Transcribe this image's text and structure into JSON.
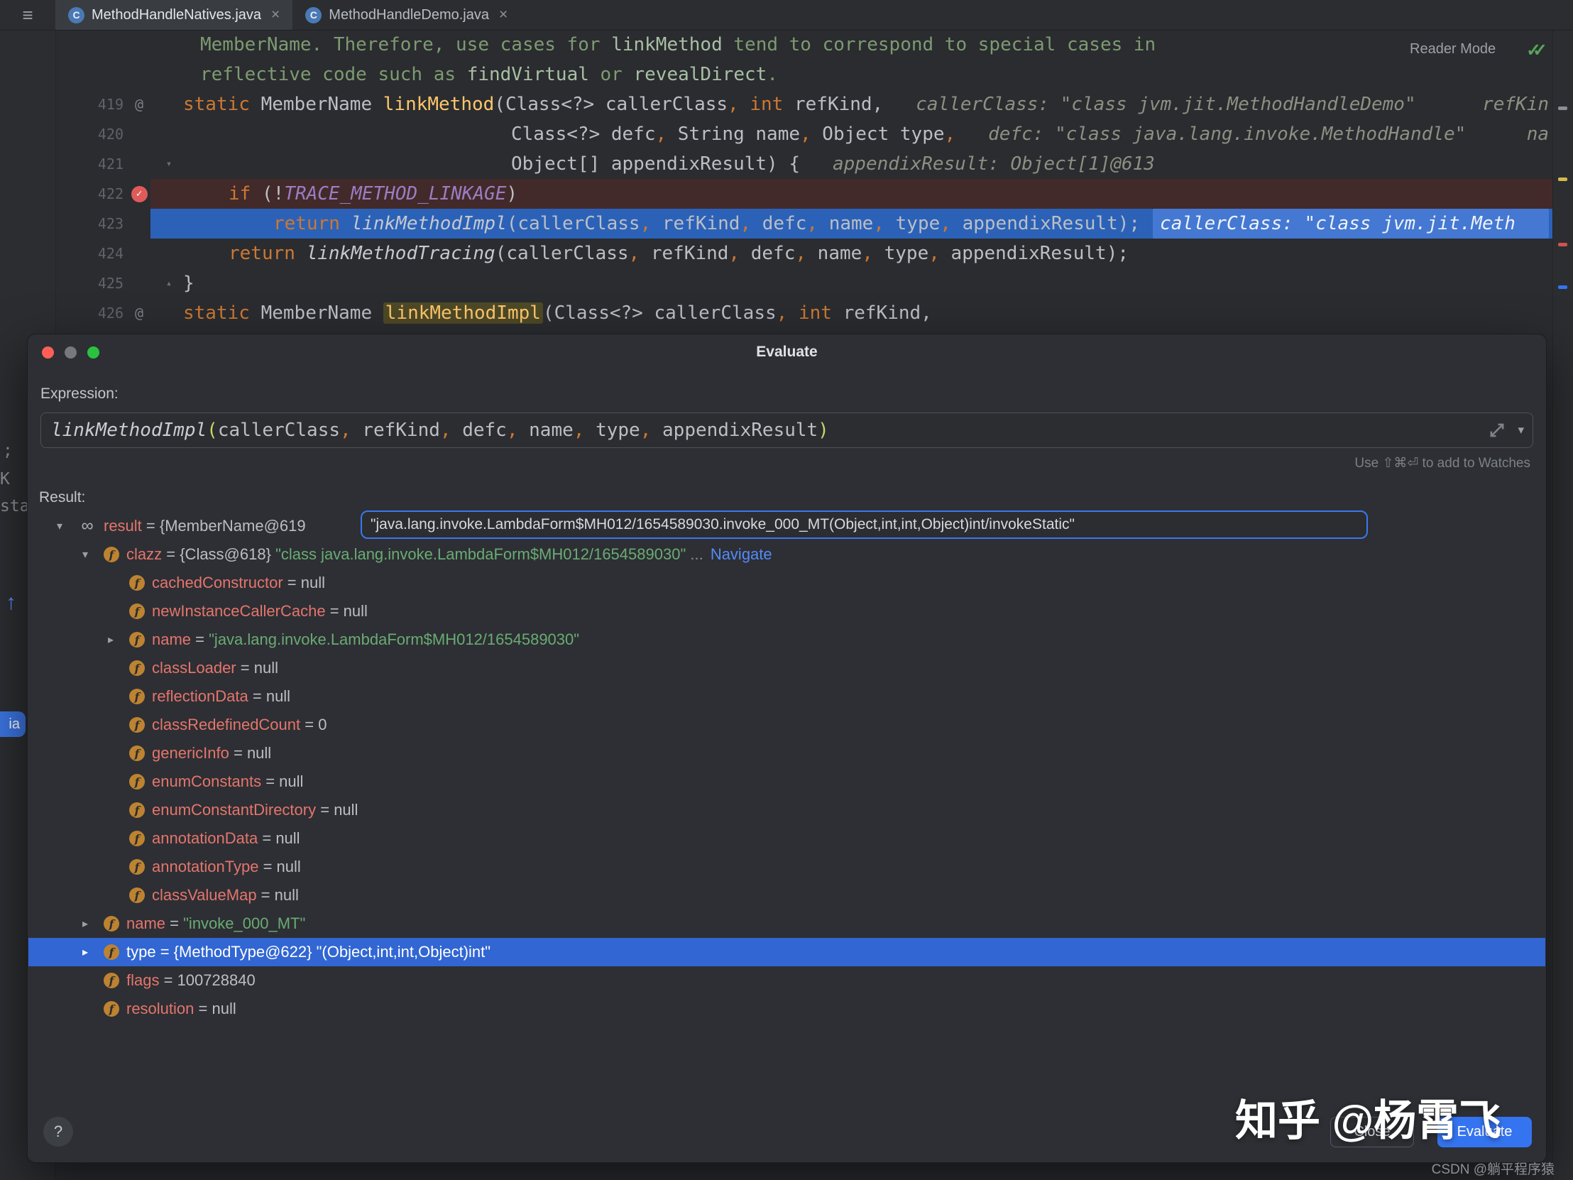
{
  "tabs": [
    {
      "label": "MethodHandleNatives.java",
      "close": "×"
    },
    {
      "label": "MethodHandleDemo.java",
      "close": "×"
    }
  ],
  "editor": {
    "reader_mode": "Reader Mode",
    "inspection_icon": "✓✓",
    "hamburger_icon": "≡",
    "lines": [
      {
        "indent": 24,
        "tokens": [
          {
            "t": "MemberName. Therefore, use cases for ",
            "c": "comment"
          },
          {
            "t": "linkMethod",
            "c": "ccode"
          },
          {
            "t": " tend to correspond to special cases in",
            "c": "comment"
          }
        ]
      },
      {
        "indent": 24,
        "tokens": [
          {
            "t": "reflective code such as ",
            "c": "comment"
          },
          {
            "t": "findVirtual",
            "c": "ccode"
          },
          {
            "t": " or ",
            "c": "comment"
          },
          {
            "t": "revealDirect",
            "c": "ccode"
          },
          {
            "t": ".",
            "c": "comment"
          }
        ]
      },
      {
        "num": "419",
        "gutter": "at",
        "indent": 0,
        "tokens": [
          {
            "t": "static ",
            "c": "kw"
          },
          {
            "t": "MemberName ",
            "c": "plain"
          },
          {
            "t": "linkMethod",
            "c": "decl"
          },
          {
            "t": "(Class<?> callerClass, ",
            "c": "args"
          },
          {
            "t": "int",
            "c": "kw"
          },
          {
            "t": " refKind,",
            "c": "plain"
          }
        ],
        "hint": "callerClass: \"class jvm.jit.MethodHandleDemo\"",
        "hint2": "refKin"
      },
      {
        "num": "420",
        "indent": 462,
        "tokens": [
          {
            "t": "Class<?> defc, String name, Object type,",
            "c": "args"
          }
        ],
        "hint": "defc: \"class java.lang.invoke.MethodHandle\"",
        "hint2": "na"
      },
      {
        "num": "421",
        "gutter": "fold",
        "indent": 462,
        "tokens": [
          {
            "t": "Object[] appendixResult) {",
            "c": "args"
          }
        ],
        "hint": "appendixResult: Object[1]@613"
      },
      {
        "num": "422",
        "gutter": "breakpoint",
        "bg": "bp",
        "indent": 64,
        "tokens": [
          {
            "t": "if",
            "c": "kw"
          },
          {
            "t": " (!",
            "c": "plain"
          },
          {
            "t": "TRACE_METHOD_LINKAGE",
            "c": "const"
          },
          {
            "t": ")",
            "c": "plain"
          }
        ]
      },
      {
        "num": "423",
        "bg": "exec",
        "indent": 127,
        "tokens": [
          {
            "t": "return ",
            "c": "kw"
          },
          {
            "t": "linkMethodImpl",
            "c": "call"
          },
          {
            "t": "(callerClass, refKind, defc, name, type, appendixResult);",
            "c": "args"
          }
        ],
        "hintbox": "callerClass: \"class jvm.jit.Meth"
      },
      {
        "num": "424",
        "indent": 64,
        "tokens": [
          {
            "t": "return ",
            "c": "kw"
          },
          {
            "t": "linkMethodTracing",
            "c": "call"
          },
          {
            "t": "(callerClass, refKind, defc, name, type, appendixResult);",
            "c": "args"
          }
        ]
      },
      {
        "num": "425",
        "gutter": "foldend",
        "indent": 0,
        "tokens": [
          {
            "t": "}",
            "c": "plain"
          }
        ]
      },
      {
        "num": "426",
        "gutter": "at",
        "indent": 0,
        "tokens": [
          {
            "t": "static ",
            "c": "kw"
          },
          {
            "t": "MemberName ",
            "c": "plain"
          },
          {
            "t": "linkMethodImpl",
            "c": "declhl"
          },
          {
            "t": "(Class<?> callerClass, ",
            "c": "args"
          },
          {
            "t": "int",
            "c": "kw"
          },
          {
            "t": " refKind,",
            "c": "plain"
          }
        ]
      }
    ]
  },
  "dialog": {
    "title": "Evaluate",
    "expression_label": "Expression:",
    "expression_tokens": [
      {
        "t": "linkMethodImpl",
        "c": "xmethod"
      },
      {
        "t": "(",
        "c": "xparen"
      },
      {
        "t": "callerClass, refKind, defc, name, type, appendixResult",
        "c": "args"
      },
      {
        "t": ")",
        "c": "xparen"
      }
    ],
    "combo_arrow": "▾",
    "watches_hint": "Use ⇧⌘⏎ to add to Watches",
    "result_label": "Result:",
    "tree": [
      {
        "depth": 0,
        "chevron": "down",
        "icon": "result",
        "name": "result",
        "sep": " = ",
        "pre": "{MemberName@619",
        "boxed_value": "\"java.lang.invoke.LambdaForm$MH012/1654589030.invoke_000_MT(Object,int,int,Object)int/invokeStatic\""
      },
      {
        "depth": 1,
        "chevron": "down",
        "icon": "field",
        "name": "clazz",
        "sep": " = ",
        "ref": "{Class@618} ",
        "str": "\"class java.lang.invoke.LambdaForm$MH012/1654589030\"",
        "ellipsis": " ... ",
        "link": "Navigate"
      },
      {
        "depth": 2,
        "icon": "field",
        "name": "cachedConstructor",
        "sep": " = ",
        "plain": "null"
      },
      {
        "depth": 2,
        "icon": "field",
        "name": "newInstanceCallerCache",
        "sep": " = ",
        "plain": "null"
      },
      {
        "depth": 2,
        "chevron": "right",
        "icon": "field",
        "name": "name",
        "sep": " = ",
        "str": "\"java.lang.invoke.LambdaForm$MH012/1654589030\""
      },
      {
        "depth": 2,
        "icon": "field",
        "name": "classLoader",
        "sep": " = ",
        "plain": "null"
      },
      {
        "depth": 2,
        "icon": "field",
        "name": "reflectionData",
        "sep": " = ",
        "plain": "null"
      },
      {
        "depth": 2,
        "icon": "field",
        "name": "classRedefinedCount",
        "sep": " = ",
        "plain": "0"
      },
      {
        "depth": 2,
        "icon": "field",
        "name": "genericInfo",
        "sep": " = ",
        "plain": "null"
      },
      {
        "depth": 2,
        "icon": "field",
        "name": "enumConstants",
        "sep": " = ",
        "plain": "null"
      },
      {
        "depth": 2,
        "icon": "field",
        "name": "enumConstantDirectory",
        "sep": " = ",
        "plain": "null"
      },
      {
        "depth": 2,
        "icon": "field",
        "name": "annotationData",
        "sep": " = ",
        "plain": "null"
      },
      {
        "depth": 2,
        "icon": "field",
        "name": "annotationType",
        "sep": " = ",
        "plain": "null"
      },
      {
        "depth": 2,
        "icon": "field",
        "name": "classValueMap",
        "sep": " = ",
        "plain": "null"
      },
      {
        "depth": 1,
        "chevron": "right",
        "icon": "field",
        "name": "name",
        "sep": " = ",
        "str": "\"invoke_000_MT\""
      },
      {
        "depth": 1,
        "chevron": "right",
        "icon": "field",
        "name": "type",
        "sep": " = ",
        "ref": "{MethodType@622} ",
        "str": "\"(Object,int,int,Object)int\"",
        "selected": true
      },
      {
        "depth": 1,
        "icon": "field",
        "name": "flags",
        "sep": " = ",
        "plain": "100728840"
      },
      {
        "depth": 1,
        "icon": "field",
        "name": "resolution",
        "sep": " = ",
        "plain": "null"
      }
    ],
    "buttons": {
      "close": "Close",
      "evaluate": "Evaluate",
      "help": "?"
    }
  },
  "fragments": {
    "f1": ";",
    "f2": "K",
    "f3": "sta",
    "arrow": "↑",
    "pill": "ia"
  },
  "watermark": {
    "big": "知乎 @杨霄飞",
    "small": "CSDN @躺平程序猿"
  }
}
